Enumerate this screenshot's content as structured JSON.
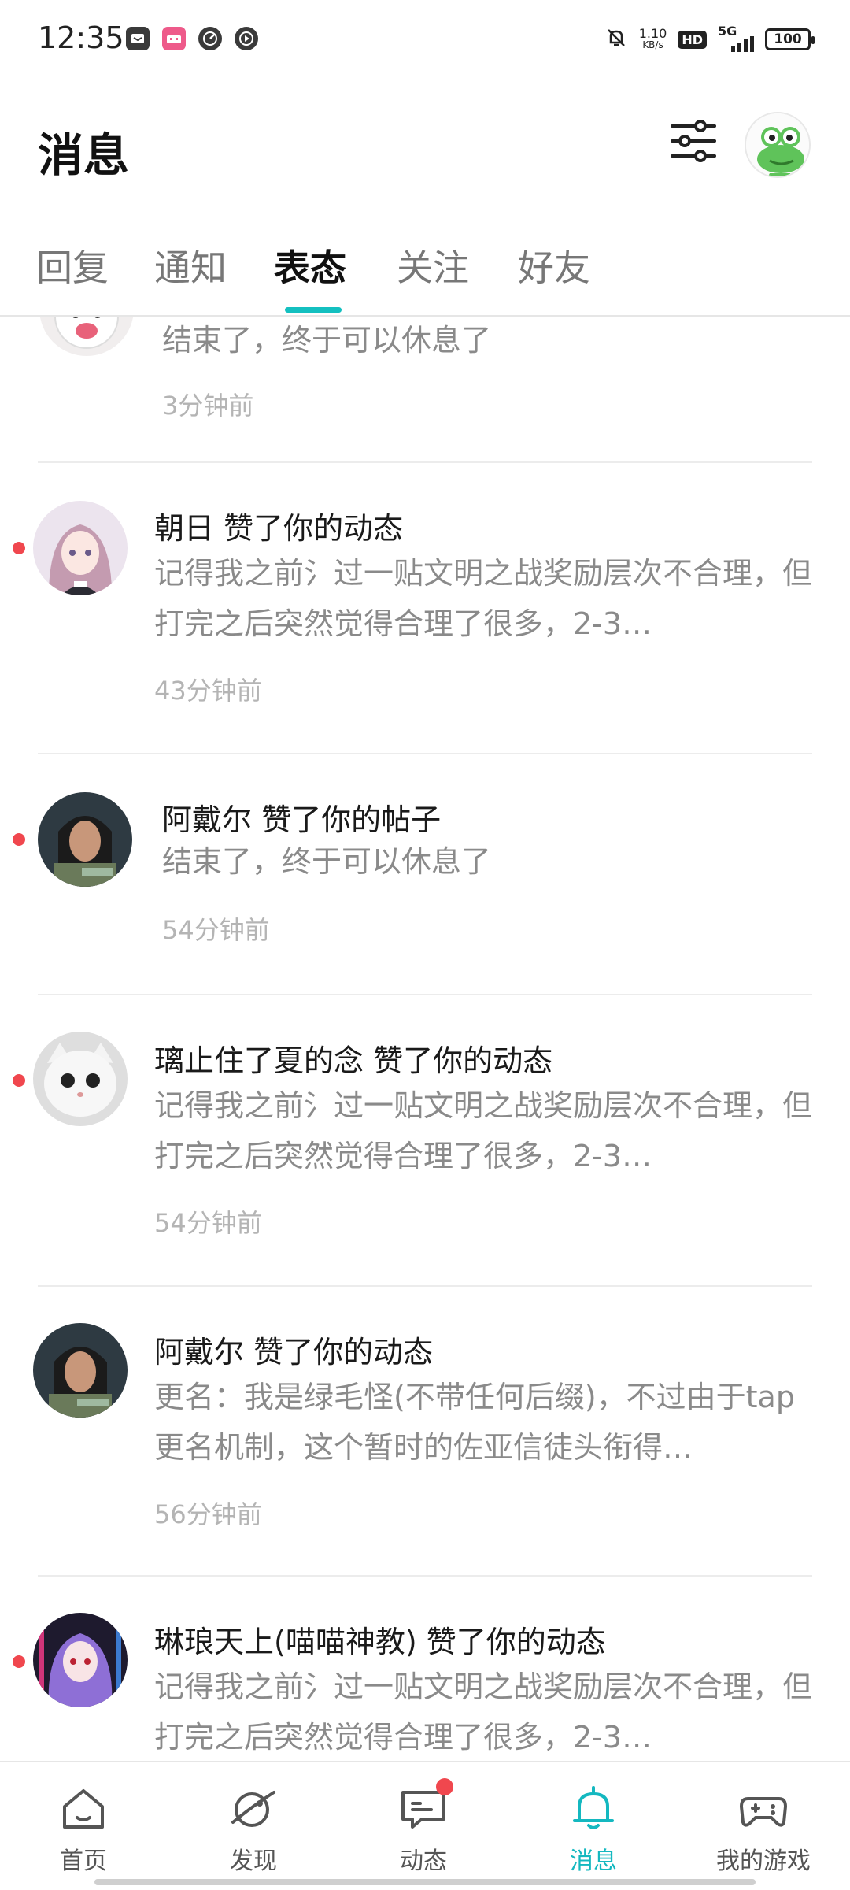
{
  "status_bar": {
    "time": "12:35",
    "speed_value": "1.10",
    "speed_unit": "KB/s",
    "hd": "HD",
    "network": "5G",
    "battery": "100",
    "app_icons": [
      "message-app-icon",
      "bilibili-icon",
      "speed-icon",
      "play-icon"
    ]
  },
  "header": {
    "title": "消息",
    "filter_icon": "sliders-icon",
    "avatar_icon": "frog-avatar"
  },
  "tabs": {
    "items": [
      {
        "label": "回复"
      },
      {
        "label": "通知"
      },
      {
        "label": "表态"
      },
      {
        "label": "关注"
      },
      {
        "label": "好友"
      }
    ],
    "active_index": 2,
    "accent_color": "#14c0c0"
  },
  "messages": [
    {
      "title": "",
      "body": "结束了，终于可以休息了",
      "time": "3分钟前",
      "unread": false
    },
    {
      "title": "朝日 赞了你的动态",
      "body": "记得我之前氵过一贴文明之战奖励层次不合理，但打完之后突然觉得合理了很多，2-3…",
      "time": "43分钟前",
      "unread": true
    },
    {
      "title": "阿戴尔 赞了你的帖子",
      "body": "结束了，终于可以休息了",
      "time": "54分钟前",
      "unread": true
    },
    {
      "title": "璃止住了夏的念 赞了你的动态",
      "body": "记得我之前氵过一贴文明之战奖励层次不合理，但打完之后突然觉得合理了很多，2-3…",
      "time": "54分钟前",
      "unread": true
    },
    {
      "title": "阿戴尔 赞了你的动态",
      "body": "更名：我是绿毛怪(不带任何后缀)，不过由于tap更名机制，这个暂时的佐亚信徒头衔得…",
      "time": "56分钟前",
      "unread": false
    },
    {
      "title": "琳琅天上(喵喵神教) 赞了你的动态",
      "body": "记得我之前氵过一贴文明之战奖励层次不合理，但打完之后突然觉得合理了很多，2-3…",
      "time": "",
      "unread": true
    }
  ],
  "bottom_nav": {
    "items": [
      {
        "label": "首页",
        "icon": "home-icon"
      },
      {
        "label": "发现",
        "icon": "planet-icon"
      },
      {
        "label": "动态",
        "icon": "chat-icon",
        "badge": true
      },
      {
        "label": "消息",
        "icon": "bell-icon",
        "active": true
      },
      {
        "label": "我的游戏",
        "icon": "gamepad-icon"
      }
    ],
    "active_color": "#14b8c0"
  }
}
